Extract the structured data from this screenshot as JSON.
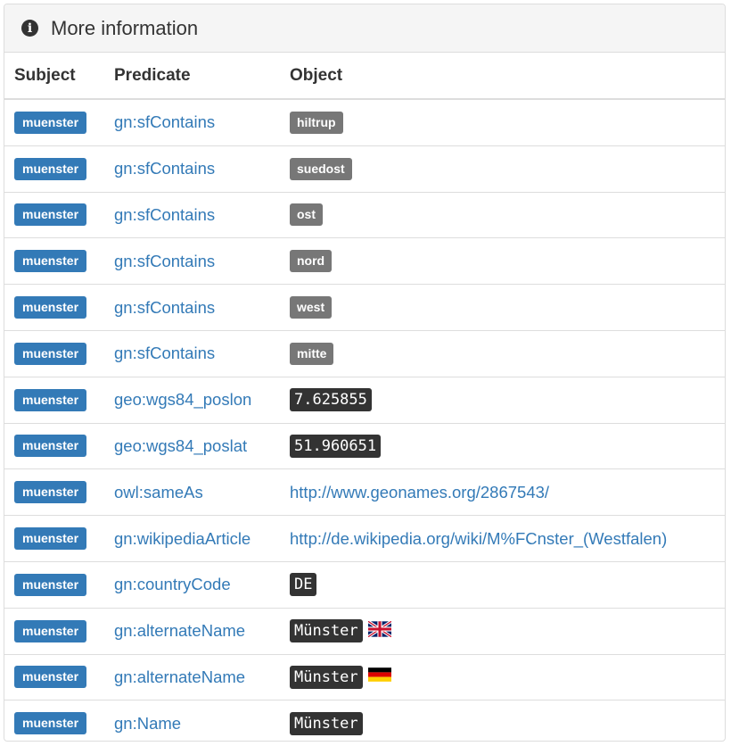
{
  "panel": {
    "title": "More information",
    "icon": "info-icon"
  },
  "columns": {
    "subject": "Subject",
    "predicate": "Predicate",
    "object": "Object"
  },
  "rows": [
    {
      "subject": "muenster",
      "predicate": "gn:sfContains",
      "object": "hiltrup",
      "kind": "label"
    },
    {
      "subject": "muenster",
      "predicate": "gn:sfContains",
      "object": "suedost",
      "kind": "label"
    },
    {
      "subject": "muenster",
      "predicate": "gn:sfContains",
      "object": "ost",
      "kind": "label"
    },
    {
      "subject": "muenster",
      "predicate": "gn:sfContains",
      "object": "nord",
      "kind": "label"
    },
    {
      "subject": "muenster",
      "predicate": "gn:sfContains",
      "object": "west",
      "kind": "label"
    },
    {
      "subject": "muenster",
      "predicate": "gn:sfContains",
      "object": "mitte",
      "kind": "label"
    },
    {
      "subject": "muenster",
      "predicate": "geo:wgs84_poslon",
      "object": "7.625855",
      "kind": "code"
    },
    {
      "subject": "muenster",
      "predicate": "geo:wgs84_poslat",
      "object": "51.960651",
      "kind": "code"
    },
    {
      "subject": "muenster",
      "predicate": "owl:sameAs",
      "object": "http://www.geonames.org/2867543/",
      "kind": "link"
    },
    {
      "subject": "muenster",
      "predicate": "gn:wikipediaArticle",
      "object": "http://de.wikipedia.org/wiki/M%FCnster_(Westfalen)",
      "kind": "link"
    },
    {
      "subject": "muenster",
      "predicate": "gn:countryCode",
      "object": "DE",
      "kind": "code"
    },
    {
      "subject": "muenster",
      "predicate": "gn:alternateName",
      "object": "Münster",
      "kind": "code",
      "flag": "uk-flag-icon"
    },
    {
      "subject": "muenster",
      "predicate": "gn:alternateName",
      "object": "Münster",
      "kind": "code",
      "flag": "de-flag-icon"
    },
    {
      "subject": "muenster",
      "predicate": "gn:Name",
      "object": "Münster",
      "kind": "code"
    }
  ],
  "colors": {
    "primary": "#337ab7",
    "default_label": "#777777",
    "code_bg": "#333333"
  }
}
